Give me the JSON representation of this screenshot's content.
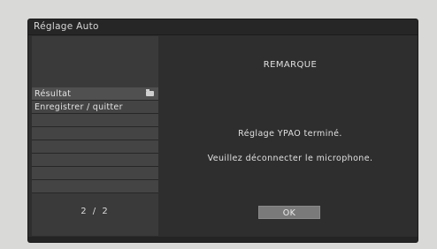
{
  "window": {
    "title": "Réglage Auto"
  },
  "menu": {
    "items": [
      {
        "label": "Résultat",
        "icon": "folder-icon"
      },
      {
        "label": "Enregistrer / quitter"
      },
      {
        "label": ""
      },
      {
        "label": ""
      },
      {
        "label": ""
      },
      {
        "label": ""
      },
      {
        "label": ""
      },
      {
        "label": ""
      }
    ],
    "page_indicator": "2 / 2"
  },
  "dialog": {
    "heading": "REMARQUE",
    "message_1": "Réglage YPAO terminé.",
    "message_2": "Veuillez déconnecter le microphone.",
    "ok_label": "OK"
  }
}
